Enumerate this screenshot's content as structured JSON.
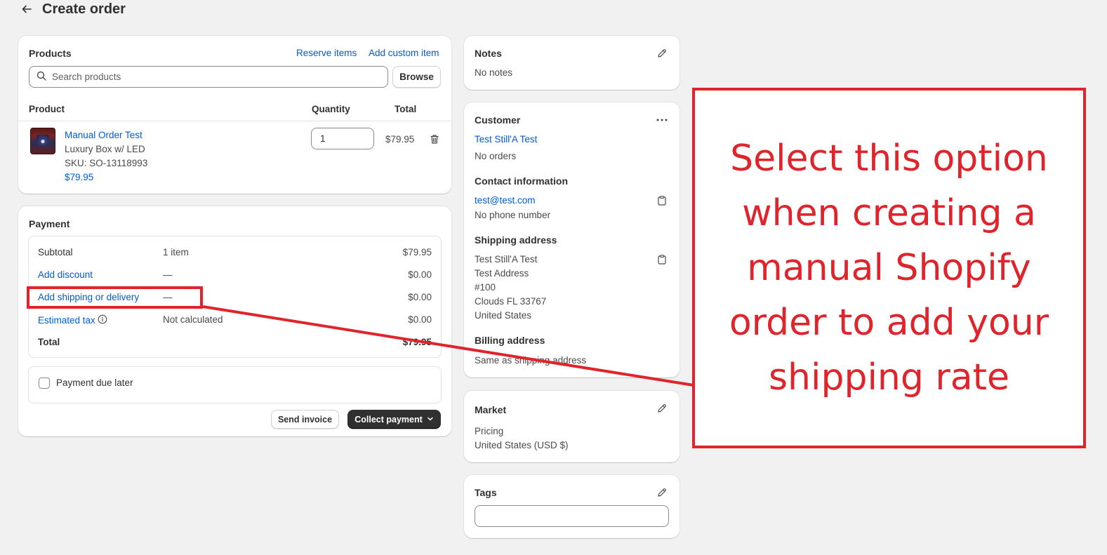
{
  "header": {
    "title": "Create order"
  },
  "products": {
    "title": "Products",
    "reserve_items": "Reserve items",
    "add_custom_item": "Add custom item",
    "search_placeholder": "Search products",
    "browse": "Browse",
    "columns": [
      "Product",
      "Quantity",
      "Total"
    ],
    "item": {
      "name": "Manual Order Test",
      "variant": "Luxury Box w/ LED",
      "sku": "SKU: SO-13118993",
      "price": "$79.95",
      "quantity": "1",
      "total": "$79.95"
    }
  },
  "payment": {
    "title": "Payment",
    "rows": [
      {
        "label": "Subtotal",
        "detail": "1 item",
        "amount": "$79.95"
      },
      {
        "label": "Add discount",
        "detail": "—",
        "amount": "$0.00"
      },
      {
        "label": "Add shipping or delivery",
        "detail": "—",
        "amount": "$0.00"
      },
      {
        "label": "Estimated tax",
        "detail": "Not calculated",
        "amount": "$0.00"
      },
      {
        "label": "Total",
        "detail": "",
        "amount": "$79.95"
      }
    ],
    "payment_due_later": "Payment due later",
    "send_invoice": "Send invoice",
    "collect_payment": "Collect payment"
  },
  "notes": {
    "title": "Notes",
    "value": "No notes"
  },
  "customer": {
    "title": "Customer",
    "name": "Test Still'A Test",
    "orders": "No orders",
    "contact_title": "Contact information",
    "email": "test@test.com",
    "phone": "No phone number",
    "shipping_title": "Shipping address",
    "shipping_lines": [
      "Test Still'A Test",
      "Test Address",
      "#100",
      "Clouds FL 33767",
      "United States"
    ],
    "billing_title": "Billing address",
    "billing_value": "Same as shipping address"
  },
  "market": {
    "title": "Market",
    "pricing_label": "Pricing",
    "pricing_value": "United States (USD $)"
  },
  "tags": {
    "title": "Tags"
  },
  "annotation": {
    "text": "Select this option when creating a manual Shopify order to add your shipping rate",
    "color": "#e0242c"
  }
}
